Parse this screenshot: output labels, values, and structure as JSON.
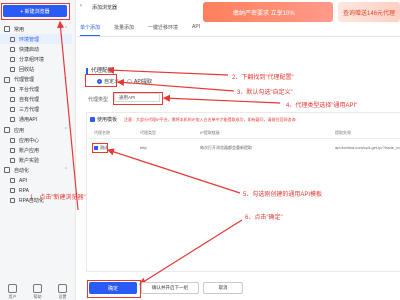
{
  "sidebar": {
    "new_button": "+ 新建浏览器",
    "items": [
      {
        "label": "常用",
        "type": "group"
      },
      {
        "label": "环境管理",
        "type": "sub",
        "active": true
      },
      {
        "label": "快捷启动",
        "type": "sub"
      },
      {
        "label": "分享组环境",
        "type": "sub"
      },
      {
        "label": "回收站",
        "type": "sub"
      },
      {
        "label": "代理管理",
        "type": "group"
      },
      {
        "label": "平台代理",
        "type": "sub"
      },
      {
        "label": "自有代理",
        "type": "sub"
      },
      {
        "label": "三方代理",
        "type": "sub"
      },
      {
        "label": "通用API",
        "type": "sub"
      },
      {
        "label": "应用",
        "type": "group"
      },
      {
        "label": "应用中心",
        "type": "sub"
      },
      {
        "label": "账户应用",
        "type": "sub"
      },
      {
        "label": "账户实验",
        "type": "sub"
      },
      {
        "label": "自动化",
        "type": "group"
      },
      {
        "label": "API",
        "type": "sub"
      },
      {
        "label": "RPA",
        "type": "sub"
      },
      {
        "label": "RPA自动化",
        "type": "sub"
      }
    ],
    "bottom": [
      "用户",
      "帮助",
      "设置"
    ]
  },
  "header": {
    "title": "添加浏览器",
    "tabs": [
      "单个添加",
      "批量添加",
      "一键迁移环境",
      "API"
    ],
    "promo1": "缴纳严密要求 立享10%",
    "promo2": "查询赠送146元代理"
  },
  "proxy": {
    "section_title": "代理配置",
    "radio_custom": "自定义",
    "radio_api": "API提取",
    "type_label": "代理类型",
    "type_value": "通用API"
  },
  "api_panel": {
    "title": "使用模板",
    "note": "注意：大部分代理IP平台，需将本机的IP加入白名单中才能提取成功，如有疑问，请前往官网咨询",
    "columns": [
      "代理名称",
      "代理类型",
      "IP提取链接",
      "提取失效"
    ],
    "row": {
      "name": "测试",
      "type": "http",
      "link": "每次打开浏览器都会重新提取",
      "extract": "api.lbchina.com/cy/t-get-ip/?trade_no="
    }
  },
  "annotations": [
    "1、点击\"新建浏览器\"",
    "2、下翻找到\"代理配置\"",
    "3、默认勾选\"自定义\"",
    "4、代理类型选择\"通用API\"",
    "5、勾选刚创建的通用API模板",
    "6、点击\"确定\""
  ],
  "footer": {
    "confirm": "确定",
    "confirm_next": "确认并开启下一组",
    "cancel": "取消"
  }
}
